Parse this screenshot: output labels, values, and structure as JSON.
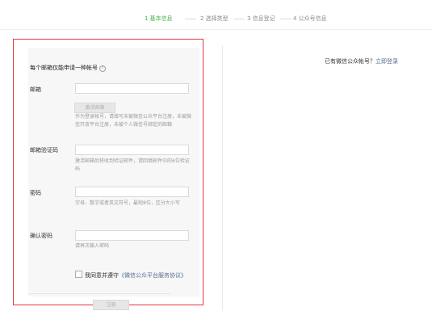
{
  "steps": [
    {
      "label": "1 基本信息",
      "active": true
    },
    {
      "label": "2 选择类型",
      "active": false
    },
    {
      "label": "3 信息登记",
      "active": false
    },
    {
      "label": "4 公众号信息",
      "active": false
    }
  ],
  "form": {
    "title": "每个邮箱仅能申请一种帐号",
    "help_glyph": "?",
    "email": {
      "label": "邮箱",
      "value": "",
      "activate_button": "激活邮箱",
      "hint": "作为登录帐号，请填写未被微信公众平台注册，未被微信开放平台注册，未被个人微信号绑定的邮箱"
    },
    "code": {
      "label": "邮箱验证码",
      "value": "",
      "hint": "激活邮箱后将收到验证邮件，请回填邮件中的6位验证码"
    },
    "password": {
      "label": "密码",
      "value": "",
      "hint": "字母、数字或者英文符号，最短8位，区分大小写"
    },
    "confirm": {
      "label": "确认密码",
      "value": "",
      "hint": "请再次输入密码"
    },
    "agreement": {
      "checked": false,
      "text": "我同意并遵守",
      "link": "《微信公众平台服务协议》"
    },
    "register_button": "注册"
  },
  "login": {
    "text": "已有微信公众帐号？",
    "link": "立即登录"
  }
}
